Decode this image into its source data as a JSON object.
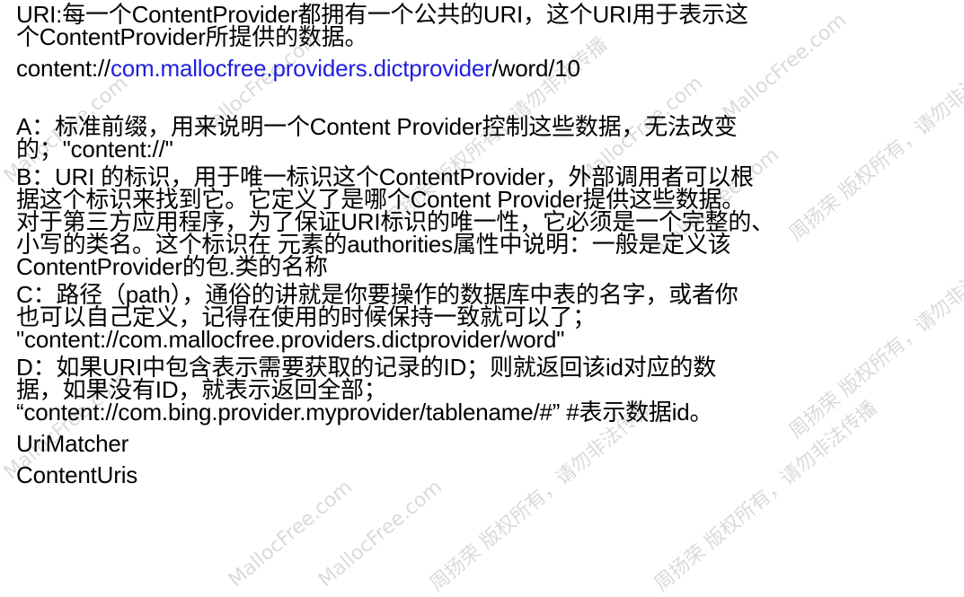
{
  "uri_intro": {
    "line1": "URI:每一个ContentProvider都拥有一个公共的URI，这个URI用于表示这",
    "line2": "个ContentProvider所提供的数据。"
  },
  "example_uri": {
    "prefix": "content://",
    "authority": "com.mallocfree.providers.dictprovider",
    "path": "/word/10"
  },
  "section_a": {
    "line1": "A：标准前缀，用来说明一个Content Provider控制这些数据，无法改变",
    "line2": "的；\"content://\""
  },
  "section_b": {
    "line1": "B：URI 的标识，用于唯一标识这个ContentProvider，外部调用者可以根",
    "line2": "据这个标识来找到它。它定义了是哪个Content Provider提供这些数据。",
    "line3": "对于第三方应用程序，为了保证URI标识的唯一性，它必须是一个完整的、",
    "line4": "小写的类名。这个标识在 元素的authorities属性中说明：一般是定义该",
    "line5": "ContentProvider的包.类的名称"
  },
  "section_c": {
    "line1": "C：路径（path），通俗的讲就是你要操作的数据库中表的名字，或者你",
    "line2": "也可以自己定义，记得在使用的时候保持一致就可以了；",
    "line3": "\"content://com.mallocfree.providers.dictprovider/word\""
  },
  "section_d": {
    "line1": "D：如果URI中包含表示需要获取的记录的ID；则就返回该id对应的数",
    "line2": "据，如果没有ID，就表示返回全部；",
    "line3": "“content://com.bing.provider.myprovider/tablename/#” #表示数据id。"
  },
  "classes": {
    "uri_matcher": "UriMatcher",
    "content_uris": "ContentUris"
  },
  "watermark": {
    "text_en": "MallocFree.com",
    "text_zh": "周扬荣 版权所有，请勿非法传播"
  }
}
